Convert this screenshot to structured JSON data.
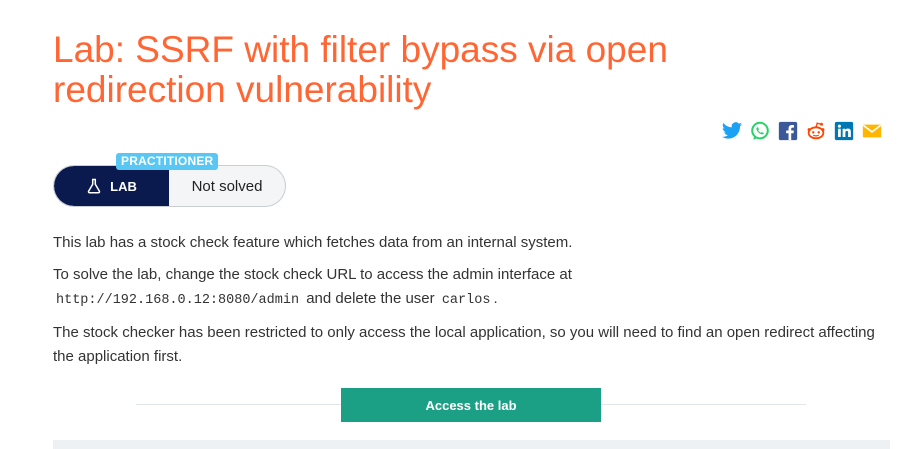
{
  "title": "Lab: SSRF with filter bypass via open redirection vulnerability",
  "share": [
    {
      "name": "twitter-icon",
      "color": "#1da1f2"
    },
    {
      "name": "whatsapp-icon",
      "color": "#25d366"
    },
    {
      "name": "facebook-icon",
      "color": "#3b5998"
    },
    {
      "name": "reddit-icon",
      "color": "#ff4500"
    },
    {
      "name": "linkedin-icon",
      "color": "#0077b5"
    },
    {
      "name": "email-icon",
      "color": "#ffb600"
    }
  ],
  "badge": {
    "level": "PRACTITIONER",
    "lab_label": "LAB",
    "status": "Not solved"
  },
  "description": {
    "p1": "This lab has a stock check feature which fetches data from an internal system.",
    "p2_a": "To solve the lab, change the stock check URL to access the admin interface at",
    "p2_code1": "http://192.168.0.12:8080/admin",
    "p2_b": "and delete the user",
    "p2_code2": "carlos",
    "p2_c": ".",
    "p3": "The stock checker has been restricted to only access the local application, so you will need to find an open redirect affecting the application first."
  },
  "access_button": "Access the lab",
  "colors": {
    "title": "#ff6633",
    "lab_pill": "#0a1a4f",
    "level_badge": "#58c7f4",
    "access_button": "#1ba085"
  }
}
